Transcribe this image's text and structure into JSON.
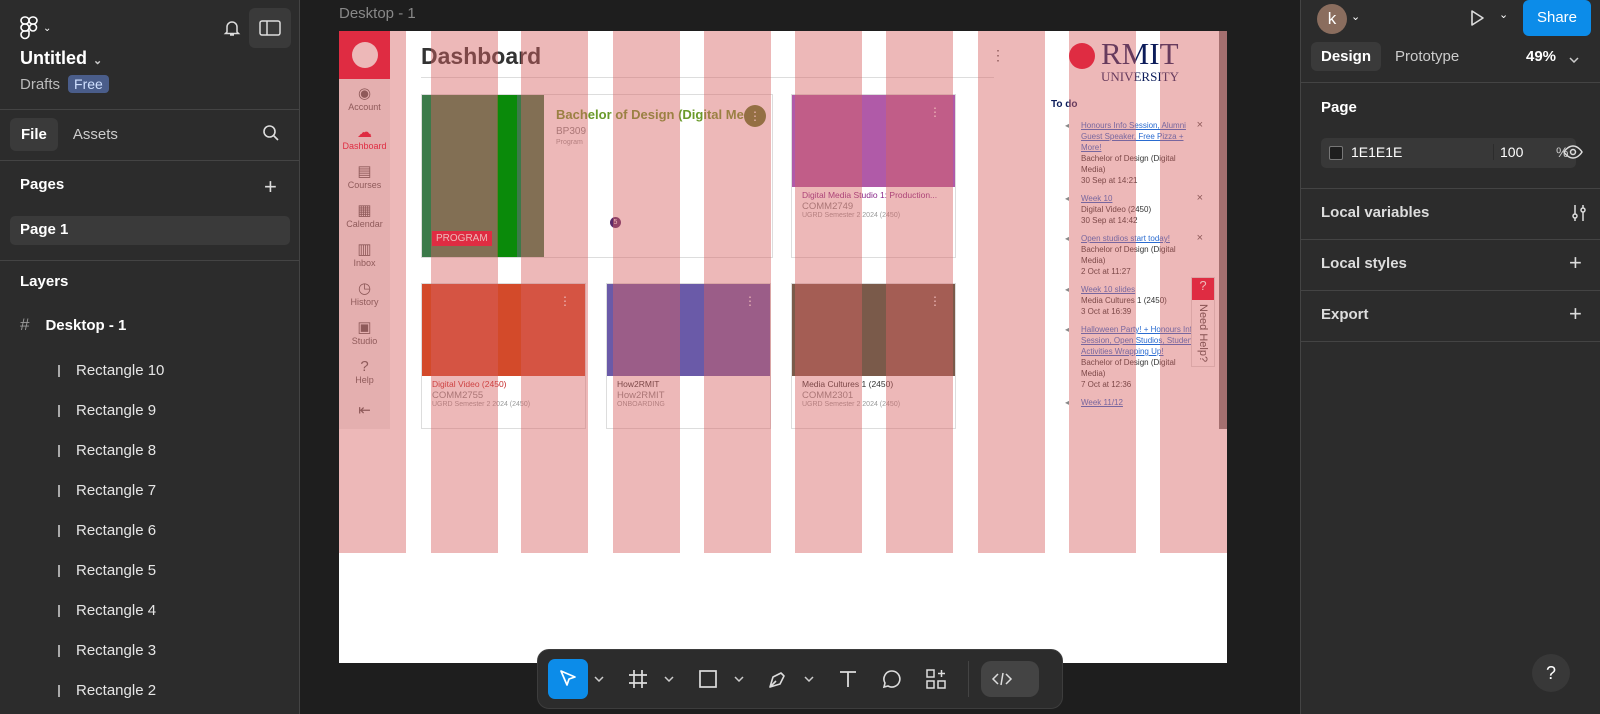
{
  "file": {
    "title": "Untitled",
    "location": "Drafts",
    "plan_badge": "Free"
  },
  "left_tabs": [
    "File",
    "Assets"
  ],
  "pages": {
    "header": "Pages",
    "items": [
      "Page 1"
    ]
  },
  "layers": {
    "header": "Layers",
    "frame": "Desktop - 1",
    "items": [
      "Rectangle 10",
      "Rectangle 9",
      "Rectangle 8",
      "Rectangle 7",
      "Rectangle 6",
      "Rectangle 5",
      "Rectangle 4",
      "Rectangle 3",
      "Rectangle 2"
    ]
  },
  "canvas": {
    "frame_label": "Desktop - 1",
    "dashboard": {
      "title": "Dashboard",
      "nav": [
        "Account",
        "Dashboard",
        "Courses",
        "Calendar",
        "Inbox",
        "History",
        "Studio",
        "Help"
      ],
      "logo_text": "RMIT",
      "logo_sub": "UNIVERSITY",
      "program_card": {
        "title": "Bachelor of Design (Digital Medi",
        "code": "BP309",
        "type": "Program",
        "badge": "PROGRAM",
        "count": "5"
      },
      "cards": [
        {
          "title": "Digital Media Studio 1: Production...",
          "code": "COMM2749",
          "term": "UGRD Semester 2 2024 (2450)"
        },
        {
          "title": "Digital Video (2450)",
          "code": "COMM2755",
          "term": "UGRD Semester 2 2024 (2450)"
        },
        {
          "title": "How2RMIT",
          "code": "How2RMIT",
          "term": "ONBOARDING"
        },
        {
          "title": "Media Cultures 1 (2450)",
          "code": "COMM2301",
          "term": "UGRD Semester 2 2024 (2450)"
        }
      ],
      "todo": {
        "header": "To do",
        "items": [
          {
            "link": "Honours Info Session, Alumni Guest Speaker, Free Pizza + More!",
            "course": "Bachelor of Design (Digital Media)",
            "date": "30 Sep at 14:21"
          },
          {
            "link": "Week 10",
            "course": "Digital Video (2450)",
            "date": "30 Sep at 14:42"
          },
          {
            "link": "Open studios start today!",
            "course": "Bachelor of Design (Digital Media)",
            "date": "2 Oct at 11:27"
          },
          {
            "link": "Week 10 slides",
            "course": "Media Cultures 1 (2450)",
            "date": "3 Oct at 16:39"
          },
          {
            "link": "Halloween Party! + Honours Info Session, Open Studios, Student Activities Wrapping Up!",
            "course": "Bachelor of Design (Digital Media)",
            "date": "7 Oct at 12:36"
          },
          {
            "link": "Week 11/12",
            "course": "",
            "date": ""
          }
        ]
      },
      "need_help": "Need Help?"
    }
  },
  "right": {
    "avatar_letter": "k",
    "share_label": "Share",
    "tabs": [
      "Design",
      "Prototype"
    ],
    "zoom": "49%",
    "page_section": "Page",
    "page_color_hex": "1E1E1E",
    "page_opacity": "100",
    "percent_sign": "%",
    "sections": [
      "Local variables",
      "Local styles",
      "Export"
    ]
  },
  "colors": {
    "accent": "#0c8ce9",
    "panel": "#2c2c2c",
    "canvas_bg": "#1e1e1e",
    "grid_overlay": "#d66161"
  }
}
